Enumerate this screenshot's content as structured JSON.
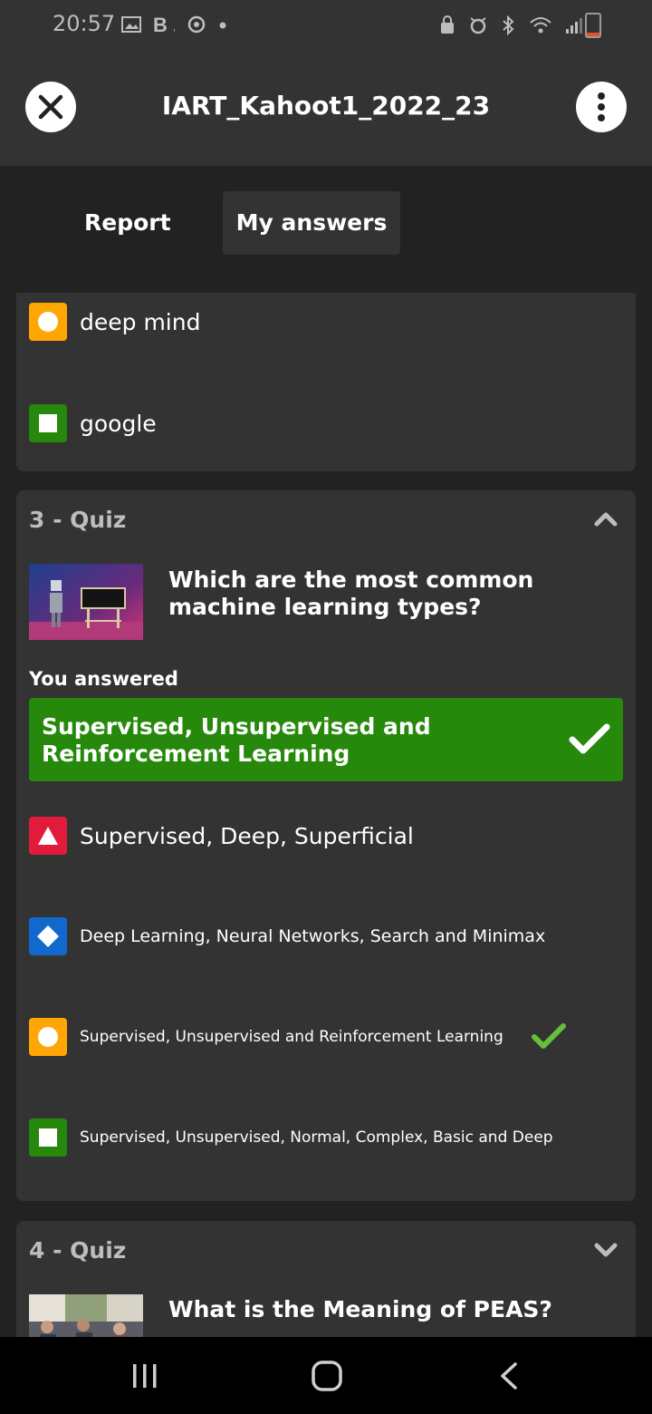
{
  "status_bar": {
    "time": "20:57",
    "left_icons": [
      "gallery-icon",
      "b-app-icon",
      "sync-icon",
      "dot-icon"
    ],
    "right_icons": [
      "lock-icon",
      "alarm-icon",
      "bluetooth-icon",
      "wifi-icon",
      "signal-icon",
      "battery-icon"
    ]
  },
  "app_bar": {
    "title": "IART_Kahoot1_2022_23",
    "close_icon": "close-icon",
    "menu_icon": "more-vert-icon"
  },
  "tabs": [
    {
      "label": "Report",
      "active": false
    },
    {
      "label": "My answers",
      "active": true
    }
  ],
  "previous_card": {
    "options": [
      {
        "shape": "circle",
        "color": "#ffa602",
        "text": "deep mind"
      },
      {
        "shape": "square",
        "color": "#26890c",
        "text": "google"
      }
    ]
  },
  "quiz3": {
    "label": "3 - Quiz",
    "expanded": true,
    "question": "Which are the most common machine learning types?",
    "you_answered_label": "You answered",
    "your_answer": "Supervised, Unsupervised and Reinforcement Learning",
    "your_answer_correct": true,
    "options": [
      {
        "shape": "triangle",
        "color": "#e21b3c",
        "text": "Supervised, Deep, Superficial",
        "correct": false
      },
      {
        "shape": "diamond",
        "color": "#1368ce",
        "text": "Deep Learning, Neural Networks, Search and Minimax",
        "correct": false
      },
      {
        "shape": "circle",
        "color": "#ffa602",
        "text": "Supervised, Unsupervised and Reinforcement Learning",
        "correct": true
      },
      {
        "shape": "square",
        "color": "#26890c",
        "text": "Supervised, Unsupervised, Normal, Complex, Basic and Deep",
        "correct": false
      }
    ]
  },
  "quiz4": {
    "label": "4 - Quiz",
    "expanded": false,
    "question": "What is the Meaning of PEAS?"
  },
  "nav_bar": {
    "icons": [
      "recent-apps-icon",
      "home-icon",
      "back-icon"
    ]
  },
  "colors": {
    "red": "#e21b3c",
    "blue": "#1368ce",
    "yellow": "#ffa602",
    "green": "#26890c",
    "correct_check": "#66bf39",
    "card_bg": "#333333",
    "page_bg": "#222222"
  }
}
